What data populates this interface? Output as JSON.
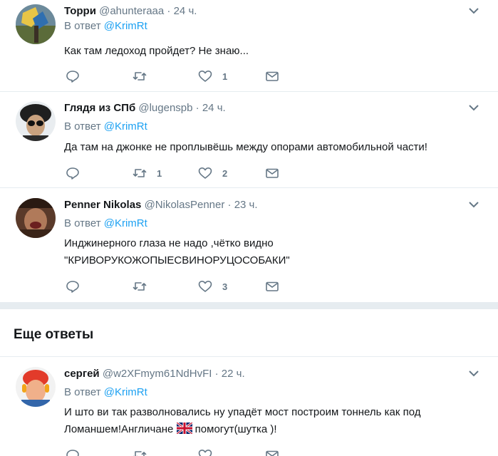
{
  "tweets": [
    {
      "name": "Торри",
      "handle": "@ahunteraaa",
      "time": "24 ч.",
      "reply_prefix": "В ответ",
      "reply_to": "@KrimRt",
      "text": "Как там ледоход пройдет? Не знаю...",
      "retweets": "",
      "likes": "1"
    },
    {
      "name": "Глядя из СПб",
      "handle": "@lugenspb",
      "time": "24 ч.",
      "reply_prefix": "В ответ",
      "reply_to": "@KrimRt",
      "text": "Да там на джонке не проплывёшь между опорами автомобильной части!",
      "retweets": "1",
      "likes": "2"
    },
    {
      "name": "Penner Nikolas",
      "handle": "@NikolasPenner",
      "time": "23 ч.",
      "reply_prefix": "В ответ",
      "reply_to": "@KrimRt",
      "text_line1": "Инджинерного глаза не надо ,чётко видно",
      "text_line2": "\"КРИВОРУКОЖОПЫЕСВИНОРУЦОСОБАКИ\"",
      "retweets": "",
      "likes": "3"
    },
    {
      "name": "сергей",
      "handle": "@w2XFmym61NdHvFI",
      "time": "22 ч.",
      "reply_prefix": "В ответ",
      "reply_to": "@KrimRt",
      "text_line1": "И што ви так разволновались ну упадёт мост построим тоннель как под",
      "text_line2_a": "Ломаншем!Англичане",
      "text_line2_b": "помогут(шутка )!",
      "retweets": "",
      "likes": ""
    }
  ],
  "more_replies_title": "Еще ответы",
  "colors": {
    "link": "#1da1f2",
    "muted": "#657786",
    "border": "#e6ecf0"
  },
  "icons": [
    "reply-icon",
    "retweet-icon",
    "like-icon",
    "dm-icon",
    "chevron-down-icon"
  ]
}
